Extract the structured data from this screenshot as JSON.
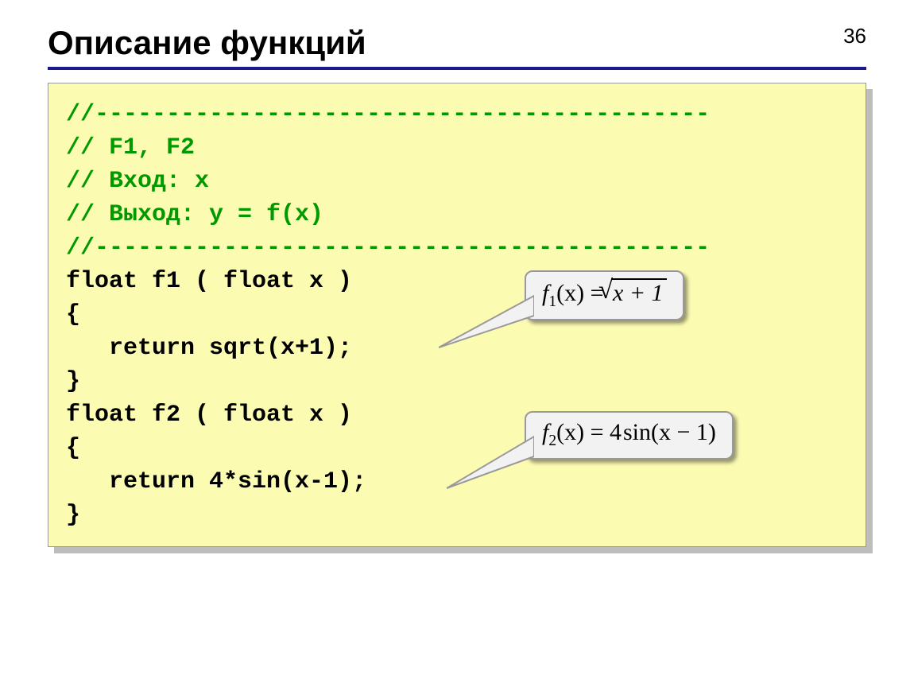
{
  "page_number": "36",
  "title": "Описание функций",
  "code": {
    "c1": "//-------------------------------------------",
    "c2": "// F1, F2",
    "c3": "// Вход: x",
    "c4": "// Выход: y = f(x)",
    "c5": "//-------------------------------------------",
    "l6": "float f1 ( float x )",
    "l7": "{",
    "l8": "   return sqrt(x+1);",
    "l9": "}",
    "l10": "float f2 ( float x )",
    "l11": "{",
    "l12": "   return 4*sin(x-1);",
    "l13": "}"
  },
  "formulas": {
    "f1": {
      "func": "f",
      "sub": "1",
      "arg": "(x)",
      "eq": " = ",
      "radicand": "x + 1"
    },
    "f2": {
      "func": "f",
      "sub": "2",
      "arg": "(x)",
      "eq": " = ",
      "coef": "4",
      "trig": "sin",
      "targ": "(x − 1)"
    }
  },
  "colors": {
    "comment": "#009900",
    "code_bg": "#fbfbb2",
    "rule": "#1a1a8a",
    "callout_bg": "#f2f2f2"
  }
}
